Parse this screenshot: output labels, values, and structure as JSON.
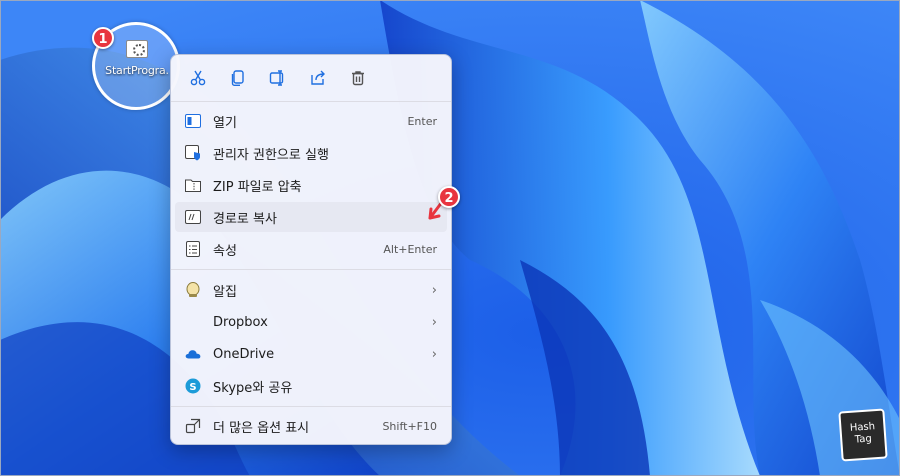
{
  "desktop": {
    "icon_label": "StartProgra."
  },
  "badges": {
    "one": "1",
    "two": "2"
  },
  "toolbar": {
    "cut": "cut-icon",
    "copy": "copy-icon",
    "rename": "rename-icon",
    "share": "share-icon",
    "delete": "delete-icon"
  },
  "menu": {
    "items": [
      {
        "label": "열기",
        "shortcut": "Enter",
        "icon": "open-icon"
      },
      {
        "label": "관리자 권한으로 실행",
        "icon": "admin-shield-icon"
      },
      {
        "label": "ZIP 파일로 압축",
        "icon": "zip-folder-icon"
      },
      {
        "label": "경로로 복사",
        "icon": "copy-path-icon"
      },
      {
        "label": "속성",
        "shortcut": "Alt+Enter",
        "icon": "properties-icon"
      },
      {
        "label": "알집",
        "icon": "alzip-icon"
      },
      {
        "label": "Dropbox",
        "icon": ""
      },
      {
        "label": "OneDrive",
        "icon": "onedrive-icon"
      },
      {
        "label": "Skype와 공유",
        "icon": "skype-icon"
      },
      {
        "label": "더 많은 옵션 표시",
        "shortcut": "Shift+F10",
        "icon": "more-options-icon"
      }
    ]
  },
  "watermark": {
    "line1": "Hash",
    "line2": "Tag"
  },
  "colors": {
    "accent": "#1f6fe0",
    "badge": "#e8353f",
    "menu_bg": "#f6f6fc"
  }
}
